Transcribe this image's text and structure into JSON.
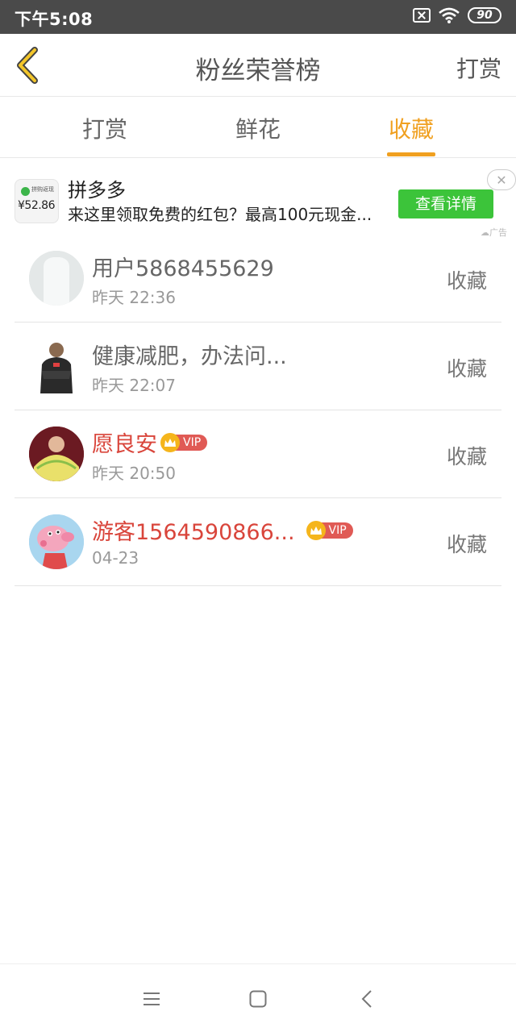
{
  "status_bar": {
    "time": "下午5:08",
    "battery": "90"
  },
  "header": {
    "title": "粉丝荣誉榜",
    "action": "打赏"
  },
  "tabs": [
    {
      "label": "打赏",
      "active": false
    },
    {
      "label": "鲜花",
      "active": false
    },
    {
      "label": "收藏",
      "active": true
    }
  ],
  "ad": {
    "icon_amount": "¥52.86",
    "icon_label": "拼购返现",
    "title": "拼多多",
    "description": "来这里领取免费的红包？最高100元现金...",
    "cta": "查看详情",
    "tag": "广告"
  },
  "fans": [
    {
      "name": "用户5868455629",
      "time": "昨天 22:36",
      "action": "收藏",
      "vip": false
    },
    {
      "name": "健康减肥，办法问...",
      "time": "昨天 22:07",
      "action": "收藏",
      "vip": false
    },
    {
      "name": "愿良安",
      "time": "昨天 20:50",
      "action": "收藏",
      "vip": true,
      "vip_label": "VIP"
    },
    {
      "name": "游客1564590866...",
      "time": "04-23",
      "action": "收藏",
      "vip": true,
      "vip_label": "VIP"
    }
  ],
  "colors": {
    "accent": "#f0a020",
    "vip_name": "#d9453b",
    "cta_green": "#3cc43a",
    "status_bar": "#4a4a4a"
  }
}
